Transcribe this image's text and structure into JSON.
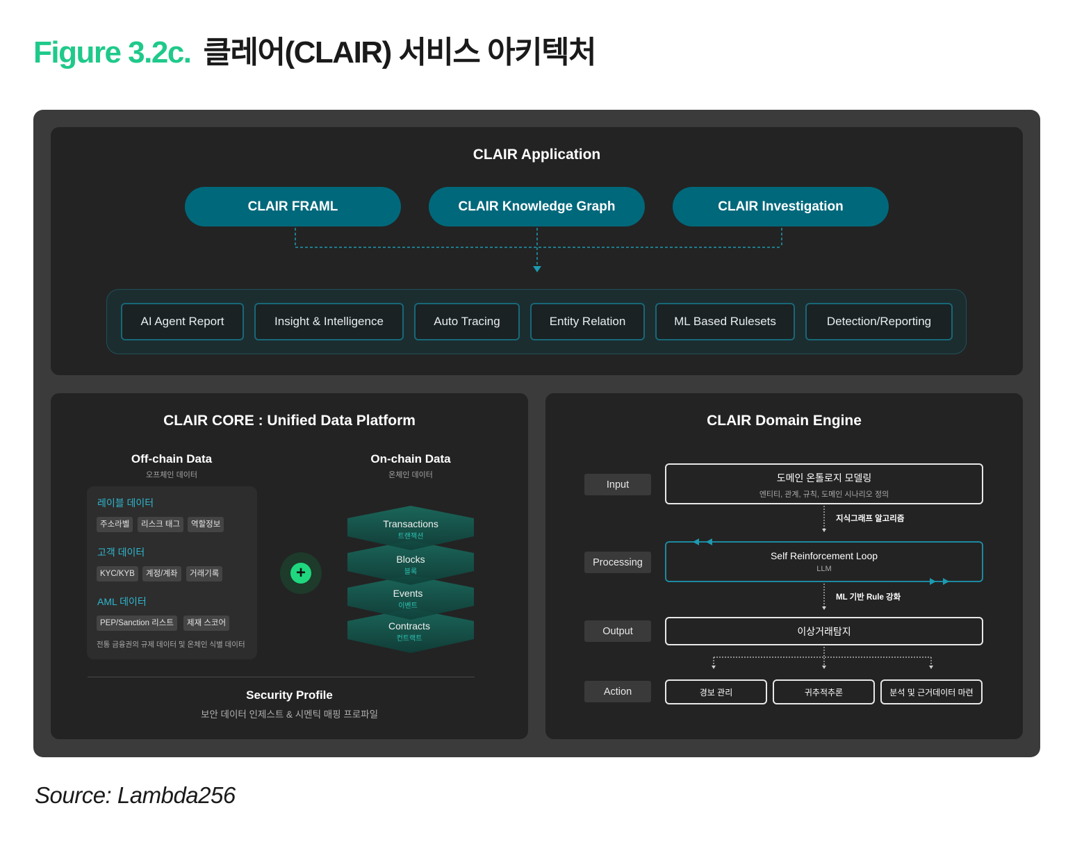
{
  "figure": {
    "number": "Figure 3.2c.",
    "title": "클레어(CLAIR) 서비스 아키텍처",
    "source": "Source: Lambda256"
  },
  "colors": {
    "accent_green": "#1fc98a",
    "teal_pill": "#00687b",
    "teal_line": "#1c9ab0",
    "outer_bg": "#3b3b3b",
    "panel_bg": "#232323"
  },
  "application": {
    "title": "CLAIR Application",
    "products": [
      "CLAIR FRAML",
      "CLAIR Knowledge Graph",
      "CLAIR Investigation"
    ],
    "features": [
      "AI Agent Report",
      "Insight & Intelligence",
      "Auto Tracing",
      "Entity Relation",
      "ML Based Rulesets",
      "Detection/Reporting"
    ]
  },
  "core": {
    "title": "CLAIR CORE : Unified Data Platform",
    "offchain": {
      "title": "Off-chain Data",
      "subtitle": "오프체인 데이터",
      "categories": [
        {
          "name": "레이블 데이터",
          "tags": [
            "주소라벨",
            "리스크 태그",
            "역할정보"
          ]
        },
        {
          "name": "고객 데이터",
          "tags": [
            "KYC/KYB",
            "계정/계좌",
            "거래기록"
          ]
        },
        {
          "name": "AML 데이터",
          "tags": [
            "PEP/Sanction 리스트",
            "제재 스코어"
          ]
        }
      ],
      "footnote": "전통 금융권의 규제 데이터 및 온체인 식별 데이터"
    },
    "plus_symbol": "+",
    "onchain": {
      "title": "On-chain Data",
      "subtitle": "온체인 데이터",
      "layers": [
        {
          "name": "Transactions",
          "sub": "트랜잭션"
        },
        {
          "name": "Blocks",
          "sub": "블록"
        },
        {
          "name": "Events",
          "sub": "이벤트"
        },
        {
          "name": "Contracts",
          "sub": "컨트랙트"
        }
      ]
    },
    "security": {
      "title": "Security Profile",
      "subtitle": "보안 데이터 인제스트 & 시멘틱 매핑 프로파일"
    }
  },
  "engine": {
    "title": "CLAIR Domain Engine",
    "stages": [
      "Input",
      "Processing",
      "Output",
      "Action"
    ],
    "input_box": {
      "title": "도메인 온톨로지 모델링",
      "sub": "엔티티, 관계, 규칙, 도메인 시나리오 정의"
    },
    "arrow1_label": "지식그래프 알고리즘",
    "loop_box": {
      "title": "Self Reinforcement Loop",
      "sub": "LLM"
    },
    "arrow2_label": "ML 기반 Rule 강화",
    "output_box": "이상거래탐지",
    "actions": [
      "경보 관리",
      "귀추적추론",
      "분석 및 근거데이터 마련"
    ]
  }
}
